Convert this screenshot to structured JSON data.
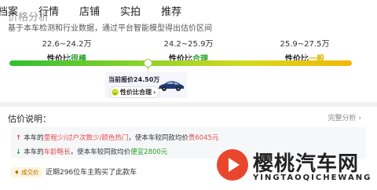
{
  "tabs": [
    "档案",
    "行情",
    "店铺",
    "实拍",
    "推荐"
  ],
  "page_title": "价格分析",
  "subtitle": "基于本车检测和行业数据，通过平台智能模型得出估价区间",
  "ranges": [
    {
      "range": "22.6~24.2万",
      "label_prefix": "性价比",
      "label_value": "很棒"
    },
    {
      "range": "24.2~25.9万",
      "label_prefix": "性价比",
      "label_value": "合理"
    },
    {
      "range": "25.9~27.5万",
      "label_prefix": "性价比",
      "label_value": "一般"
    }
  ],
  "current": {
    "price": "当前报价24.50万",
    "badge": "性价比合理",
    "badge_arrow": "›"
  },
  "explanation": {
    "title": "估价说明：",
    "full_analysis": "完整分析 ›"
  },
  "reasons": [
    {
      "arrow": "↑",
      "pre": "本车的",
      "highlight": "里程少/过户次数少/颜色热门",
      "mid": "，使本车较同款均价",
      "value": "贵6045元"
    },
    {
      "arrow": "↓",
      "pre": "本车的",
      "highlight": "车龄略长",
      "mid": "，使本车较同款均价",
      "value": "便宜2800元"
    }
  ],
  "deal": {
    "badge": "♦ 成交价",
    "text": "近期296位车主购买了此款车"
  },
  "watermark": {
    "name": "樱桃汽车网",
    "pinyin": "YINGTAOQICHEWANG"
  },
  "colors": {
    "good": "#2aa32a",
    "fair": "#e0b400",
    "expensive": "#e54b4b",
    "brand": "#e8472e"
  }
}
